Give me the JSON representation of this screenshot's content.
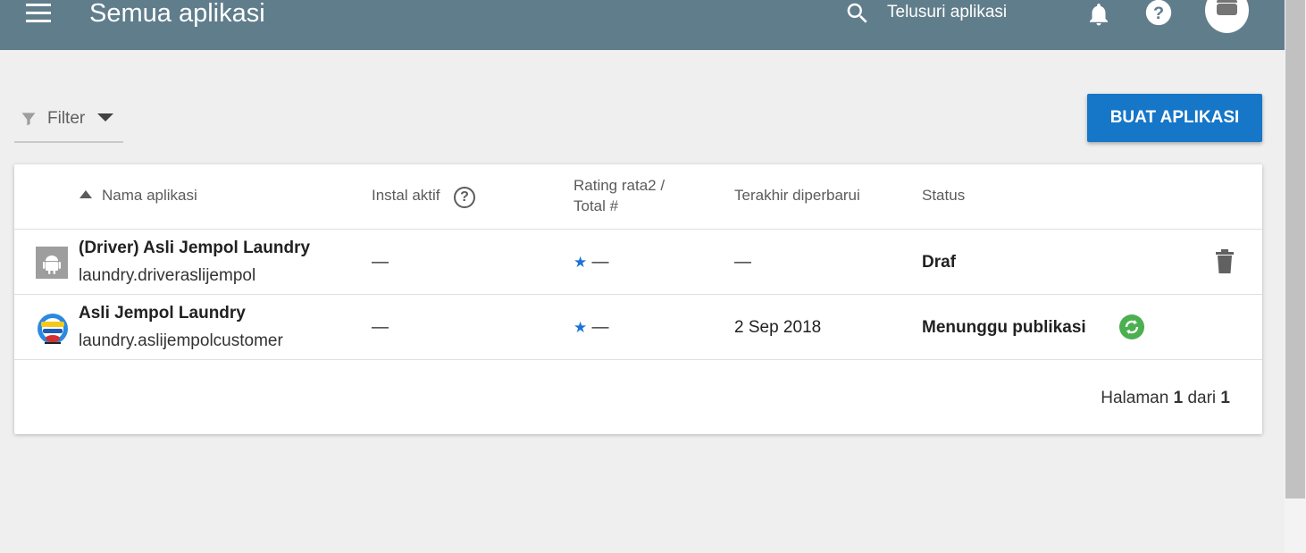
{
  "header": {
    "title": "Semua aplikasi",
    "search_placeholder": "Telusuri aplikasi",
    "help_glyph": "?",
    "icons": [
      "menu-icon",
      "search-icon",
      "bell-icon",
      "help-icon",
      "android-avatar-icon"
    ]
  },
  "toolbar": {
    "filter_label": "Filter",
    "create_button": "BUAT APLIKASI"
  },
  "table": {
    "columns": {
      "name": "Nama aplikasi",
      "installs": "Instal aktif",
      "installs_help": "?",
      "rating_line1": "Rating rata2 /",
      "rating_line2": "Total #",
      "updated": "Terakhir diperbarui",
      "status": "Status"
    },
    "rows": [
      {
        "name": "(Driver) Asli Jempol Laundry",
        "package": "laundry.driveraslijempol",
        "installs": "—",
        "rating_star": "★",
        "rating": "—",
        "updated": "—",
        "status": "Draf",
        "icon": "android-placeholder-icon",
        "action_icon": "trash-icon"
      },
      {
        "name": "Asli Jempol Laundry",
        "package": "laundry.aslijempolcustomer",
        "installs": "—",
        "rating_star": "★",
        "rating": "—",
        "updated": "2 Sep 2018",
        "status": "Menunggu publikasi",
        "icon": "asli-jempol-logo-icon",
        "action_icon": "sync-icon"
      }
    ]
  },
  "pagination": {
    "prefix": "Halaman",
    "current": "1",
    "separator": "dari",
    "total": "1"
  },
  "colors": {
    "topbar": "#607d8b",
    "primary_button": "#1676c8",
    "star": "#1a73d6",
    "sync_badge": "#4caf50"
  }
}
